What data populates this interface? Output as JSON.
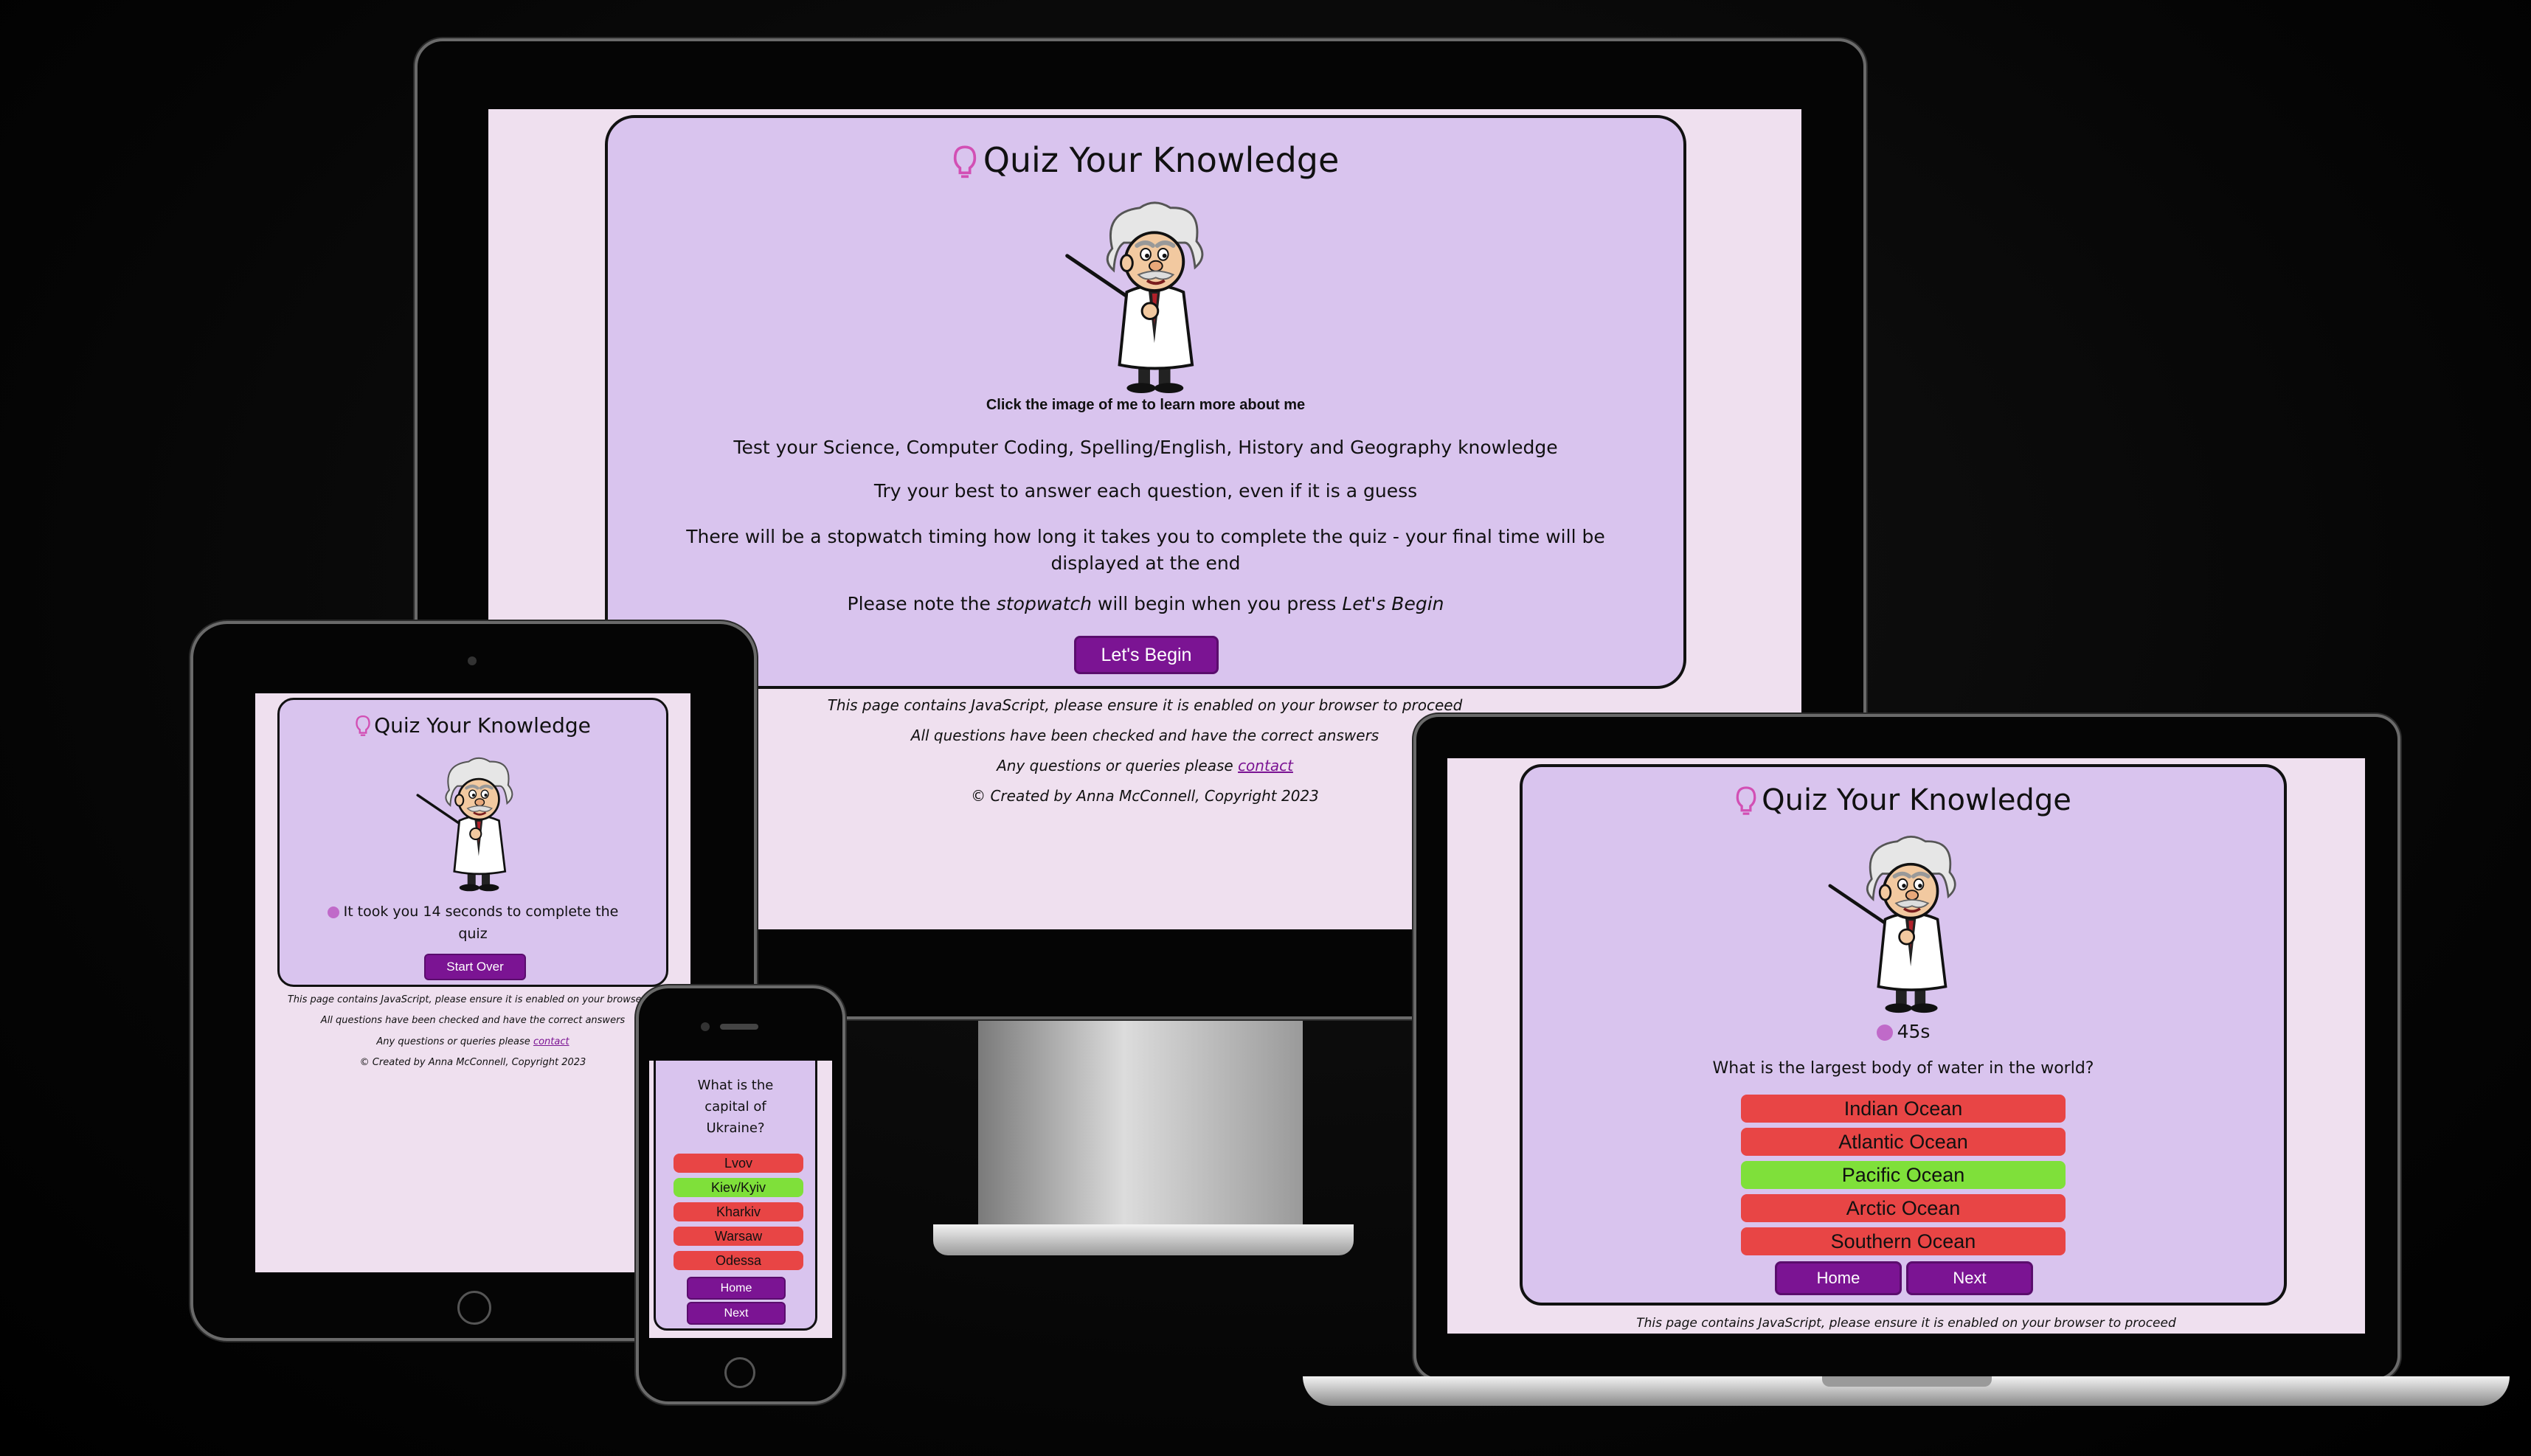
{
  "colors": {
    "card_bg": "#d9c4ee",
    "page_bg": "#efe0ef",
    "button": "#7b1493",
    "wrong": "#e84545",
    "correct": "#7fe03a",
    "bulb": "#d24fb4"
  },
  "desktop": {
    "title": "Quiz Your Knowledge",
    "image_caption": "Click the image of me to learn more about me",
    "intro_1": "Test your Science, Computer Coding, Spelling/English, History and Geography knowledge",
    "intro_2": "Try your best to answer each question, even if it is a guess",
    "intro_3": "There will be a stopwatch timing how long it takes you to complete the quiz - your final time will be displayed at the end",
    "intro_4_prefix": "Please note the ",
    "intro_4_em1": "stopwatch",
    "intro_4_mid": " will begin when you press ",
    "intro_4_em2": "Let's Begin",
    "begin_label": "Let's Begin",
    "footer_js": "This page contains JavaScript, please ensure it is enabled on your browser to proceed",
    "footer_checked": "All questions have been checked and have the correct answers",
    "footer_queries": "Any questions or queries please ",
    "footer_contact": "contact",
    "footer_copyright": "© Created by Anna McConnell, Copyright 2023"
  },
  "tablet": {
    "title": "Quiz Your Knowledge",
    "result": "It took you 14 seconds to complete the quiz",
    "start_over_label": "Start Over",
    "footer_js": "This page contains JavaScript, please ensure it is enabled on your browser to",
    "footer_checked": "All questions have been checked and have the correct answers",
    "footer_queries": "Any questions or queries please ",
    "footer_contact": "contact",
    "footer_copyright": "© Created by Anna McConnell, Copyright 2023"
  },
  "phone": {
    "question": "What is the capital of Ukraine?",
    "answers": [
      {
        "label": "Lvov",
        "state": "wrong"
      },
      {
        "label": "Kiev/Kyiv",
        "state": "correct"
      },
      {
        "label": "Kharkiv",
        "state": "wrong"
      },
      {
        "label": "Warsaw",
        "state": "wrong"
      },
      {
        "label": "Odessa",
        "state": "wrong"
      }
    ],
    "home_label": "Home",
    "next_label": "Next"
  },
  "laptop": {
    "title": "Quiz Your Knowledge",
    "timer": "45s",
    "question": "What is the largest body of water in the world?",
    "answers": [
      {
        "label": "Indian Ocean",
        "state": "wrong"
      },
      {
        "label": "Atlantic Ocean",
        "state": "wrong"
      },
      {
        "label": "Pacific Ocean",
        "state": "correct"
      },
      {
        "label": "Arctic Ocean",
        "state": "wrong"
      },
      {
        "label": "Southern Ocean",
        "state": "wrong"
      }
    ],
    "home_label": "Home",
    "next_label": "Next",
    "footer_js": "This page contains JavaScript, please ensure it is enabled on your browser to proceed"
  }
}
